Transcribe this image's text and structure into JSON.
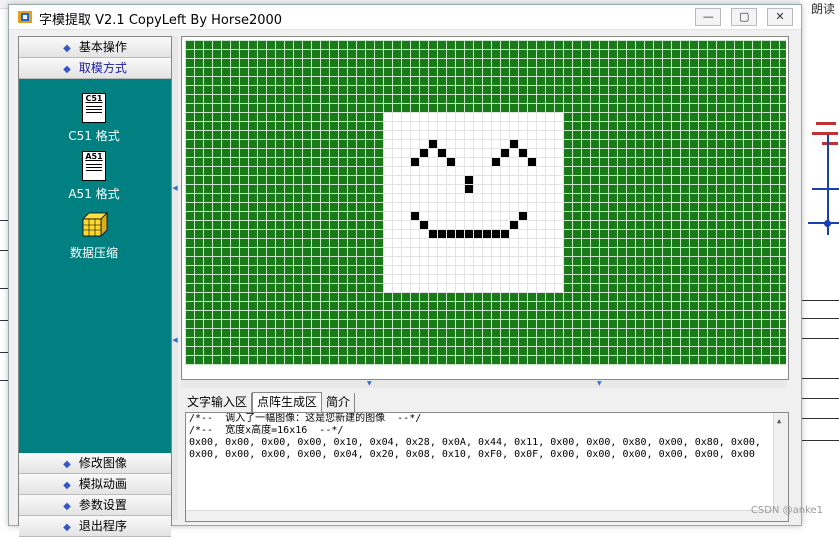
{
  "window": {
    "title": "字模提取 V2.1  CopyLeft By Horse2000",
    "buttons": {
      "minimize": "—",
      "maximize": "▢",
      "close": "✕"
    }
  },
  "sidebar": {
    "sections_top": [
      {
        "label": "基本操作",
        "active": false
      },
      {
        "label": "取模方式",
        "active": true
      }
    ],
    "tools": [
      {
        "label": "C51 格式",
        "doc_tag": "C51"
      },
      {
        "label": "A51 格式",
        "doc_tag": "A51"
      },
      {
        "label": "数据压缩",
        "doc_tag": ""
      }
    ],
    "sections_bottom": [
      {
        "label": "修改图像"
      },
      {
        "label": "模拟动画"
      },
      {
        "label": "参数设置"
      },
      {
        "label": "退出程序"
      }
    ]
  },
  "canvas": {
    "grid_color": "#1a7a1a",
    "cols": 67,
    "rows": 36,
    "image_box": {
      "col": 22,
      "row": 8,
      "width_cells": 20,
      "height_cells": 20
    },
    "pixels": [
      [
        27,
        11
      ],
      [
        26,
        12
      ],
      [
        28,
        12
      ],
      [
        25,
        13
      ],
      [
        29,
        13
      ],
      [
        36,
        11
      ],
      [
        35,
        12
      ],
      [
        37,
        12
      ],
      [
        34,
        13
      ],
      [
        38,
        13
      ],
      [
        31,
        15
      ],
      [
        31,
        16
      ],
      [
        25,
        19
      ],
      [
        26,
        20
      ],
      [
        27,
        21
      ],
      [
        28,
        21
      ],
      [
        29,
        21
      ],
      [
        30,
        21
      ],
      [
        31,
        21
      ],
      [
        32,
        21
      ],
      [
        33,
        21
      ],
      [
        34,
        21
      ],
      [
        35,
        21
      ],
      [
        36,
        20
      ],
      [
        37,
        19
      ]
    ]
  },
  "tabs": [
    {
      "label": "文字输入区",
      "active": false
    },
    {
      "label": "点阵生成区",
      "active": true
    },
    {
      "label": "简介",
      "active": false
    }
  ],
  "output": {
    "lines": [
      "/*--  调入了一幅图像：这是您新建的图像  --*/",
      "/*--  宽度x高度=16x16  --*/",
      "0x00, 0x00, 0x00, 0x00, 0x10, 0x04, 0x28, 0x0A, 0x44, 0x11, 0x00, 0x00, 0x80, 0x00, 0x80, 0x00,",
      "0x00, 0x00, 0x00, 0x00, 0x04, 0x20, 0x08, 0x10, 0xF0, 0x0F, 0x00, 0x00, 0x00, 0x00, 0x00, 0x00"
    ]
  },
  "background": {
    "right_label": "朗读",
    "watermark": "CSDN @anke1"
  }
}
